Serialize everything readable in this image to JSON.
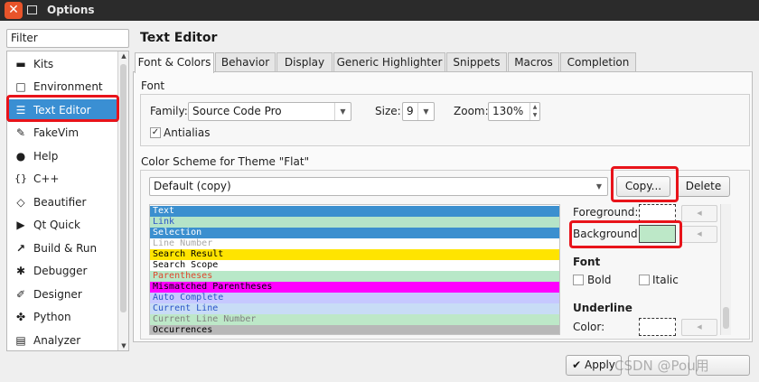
{
  "window": {
    "title": "Options"
  },
  "filter": {
    "value": "Filter"
  },
  "categories": [
    {
      "label": "Kits",
      "icon": "monitor-icon"
    },
    {
      "label": "Environment",
      "icon": "monitor-icon"
    },
    {
      "label": "Text Editor",
      "icon": "document-icon",
      "selected": true
    },
    {
      "label": "FakeVim",
      "icon": "fakevim-icon"
    },
    {
      "label": "Help",
      "icon": "help-icon"
    },
    {
      "label": "C++",
      "icon": "braces-icon"
    },
    {
      "label": "Beautifier",
      "icon": "diamond-icon"
    },
    {
      "label": "Qt Quick",
      "icon": "play-icon"
    },
    {
      "label": "Build & Run",
      "icon": "hammer-icon"
    },
    {
      "label": "Debugger",
      "icon": "bug-icon"
    },
    {
      "label": "Designer",
      "icon": "pen-icon"
    },
    {
      "label": "Python",
      "icon": "python-icon"
    },
    {
      "label": "Analyzer",
      "icon": "analyzer-icon"
    }
  ],
  "page": {
    "title": "Text Editor"
  },
  "tabs": [
    "Font & Colors",
    "Behavior",
    "Display",
    "Generic Highlighter",
    "Snippets",
    "Macros",
    "Completion"
  ],
  "font": {
    "section": "Font",
    "family_label": "Family:",
    "family_value": "Source Code Pro",
    "size_label": "Size:",
    "size_value": "9",
    "zoom_label": "Zoom:",
    "zoom_value": "130%",
    "antialias_label": "Antialias"
  },
  "scheme": {
    "section": "Color Scheme for Theme \"Flat\"",
    "selected": "Default (copy)",
    "copy_label": "Copy...",
    "delete_label": "Delete",
    "items": [
      {
        "label": "Text",
        "fg": "#ffffff",
        "bg": "#3b8fcf"
      },
      {
        "label": "Link",
        "fg": "#2a55c8",
        "bg": "#b5e4c8"
      },
      {
        "label": "Selection",
        "fg": "#ffffff",
        "bg": "#3b8fcf"
      },
      {
        "label": "Line Number",
        "fg": "#a8a8a8",
        "bg": "#ffffff"
      },
      {
        "label": "Search Result",
        "fg": "#000000",
        "bg": "#ffe400"
      },
      {
        "label": "Search Scope",
        "fg": "#000000",
        "bg": "#ffffff"
      },
      {
        "label": "Parentheses",
        "fg": "#e0482e",
        "bg": "#b8e8c8"
      },
      {
        "label": "Mismatched Parentheses",
        "fg": "#000000",
        "bg": "#ff00ff"
      },
      {
        "label": "Auto Complete",
        "fg": "#2a55c8",
        "bg": "#c6c8ff"
      },
      {
        "label": "Current Line",
        "fg": "#2a55c8",
        "bg": "#c8dcf6"
      },
      {
        "label": "Current Line Number",
        "fg": "#808080",
        "bg": "#bde8c8"
      },
      {
        "label": "Occurrences",
        "fg": "#000000",
        "bg": "#b8b8b8"
      }
    ]
  },
  "props": {
    "foreground_label": "Foreground:",
    "background_label": "Background:",
    "background_color": "#bde8c8",
    "font_label": "Font",
    "bold_label": "Bold",
    "italic_label": "Italic",
    "underline_label": "Underline",
    "color_label": "Color:"
  },
  "footer": {
    "apply_label": "Apply",
    "watermark": "CSDN @Pou用"
  }
}
